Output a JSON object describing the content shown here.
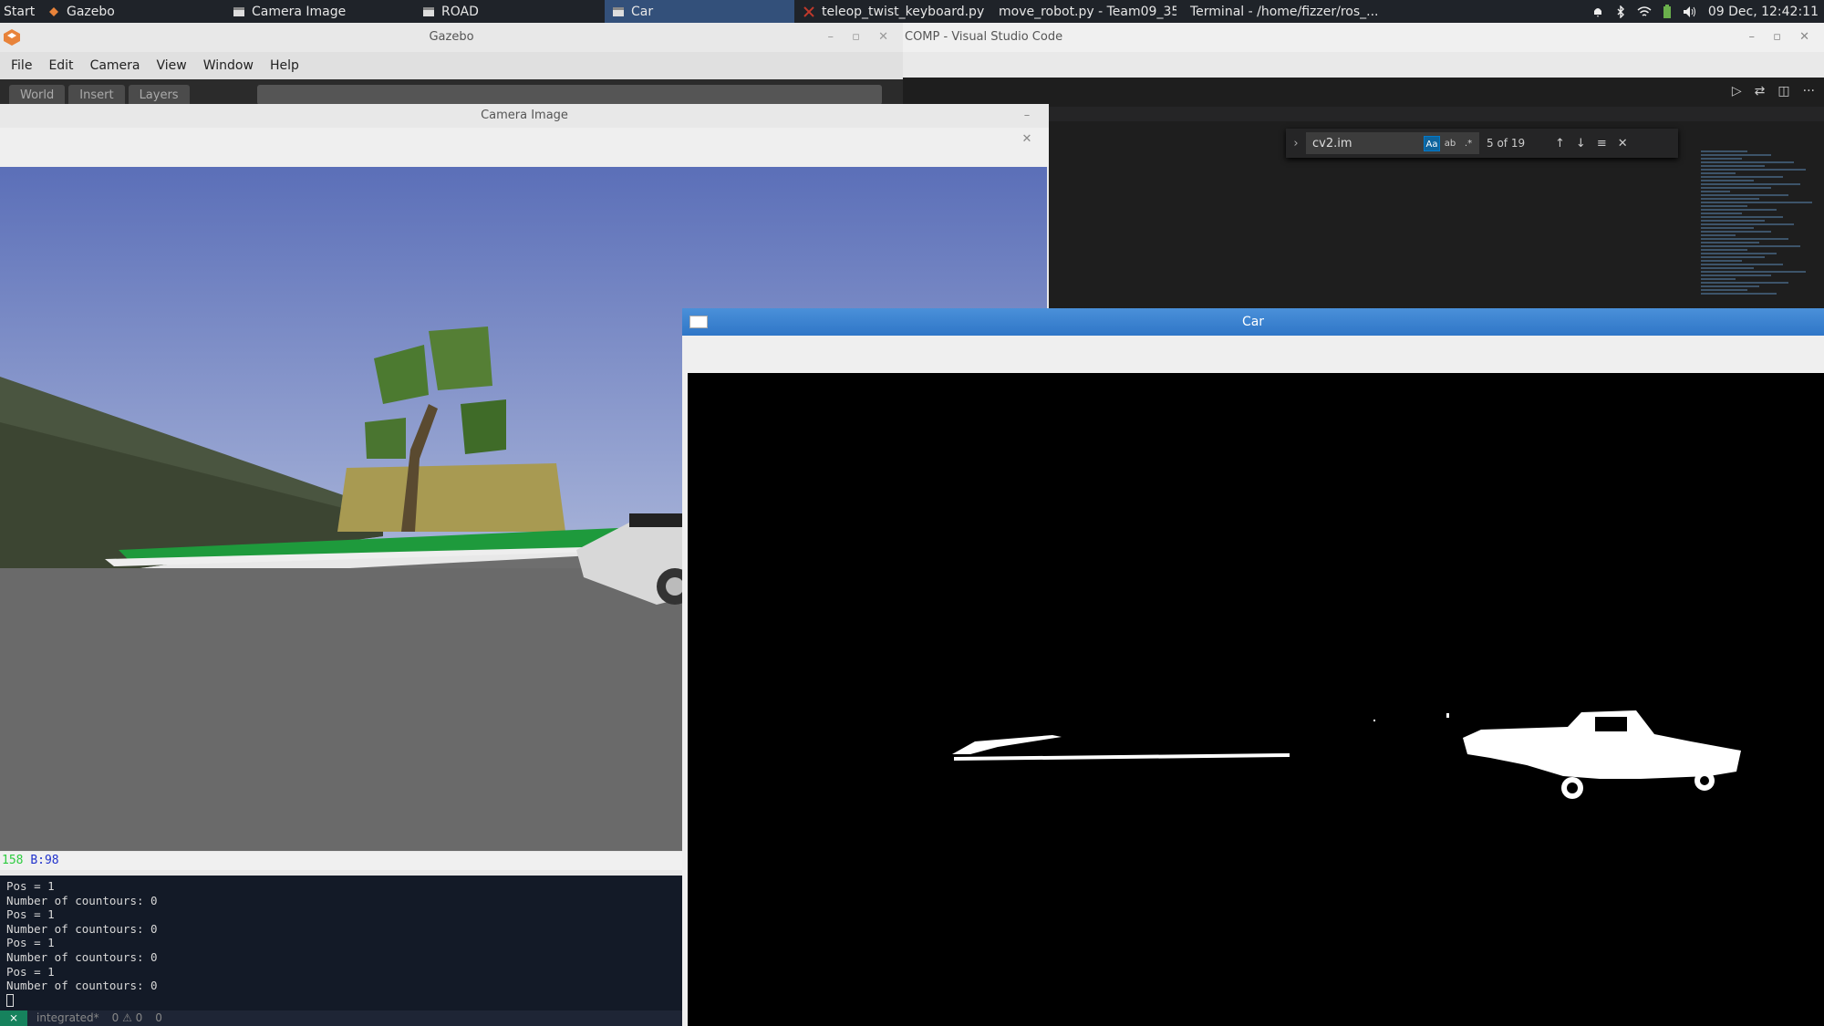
{
  "taskbar": {
    "start_label": "Start",
    "tasks": [
      {
        "label": "Gazebo",
        "icon": "gazebo-icon"
      },
      {
        "label": "Camera Image",
        "icon": "window-icon"
      },
      {
        "label": "ROAD",
        "icon": "window-icon"
      },
      {
        "label": "Car",
        "icon": "window-icon",
        "active": true
      },
      {
        "label": "teleop_twist_keyboard.py",
        "icon": "x-icon"
      },
      {
        "label": "move_robot.py - Team09_35...",
        "icon": "vscode-icon"
      },
      {
        "label": "Terminal - /home/fizzer/ros_...",
        "icon": "terminal-icon"
      }
    ],
    "clock": "09 Dec, 12:42:11"
  },
  "gazebo": {
    "title": "Gazebo",
    "menu": [
      "File",
      "Edit",
      "Camera",
      "View",
      "Window",
      "Help"
    ],
    "tabs": [
      "World",
      "Insert",
      "Layers"
    ]
  },
  "vscode": {
    "title": "COMP - Visual Studio Code",
    "find": {
      "query": "cv2.im",
      "match_case": "Aa",
      "whole_word": "ab",
      "regex": ".*",
      "count": "5 of 19"
    }
  },
  "camera_window": {
    "title": "Camera Image",
    "pixel_info_g": "158",
    "pixel_info_b": "B:98"
  },
  "terminal": {
    "lines": [
      "Pos =  1",
      "Number of countours: 0",
      "Pos =  1",
      "Number of countours: 0",
      "Pos =  1",
      "Number of countours: 0",
      "Pos =  1",
      "Number of countours: 0"
    ],
    "status": {
      "branch": "integrated*",
      "problems": "0 ⚠ 0",
      "ports": "0"
    }
  },
  "car_window": {
    "title": "Car"
  },
  "colors": {
    "taskbar_bg": "#1f2329",
    "active_task": "#33507a",
    "vscode_bg": "#1e1e1e",
    "car_titlebar": "#3a84d2",
    "term_bg": "#131a27"
  }
}
